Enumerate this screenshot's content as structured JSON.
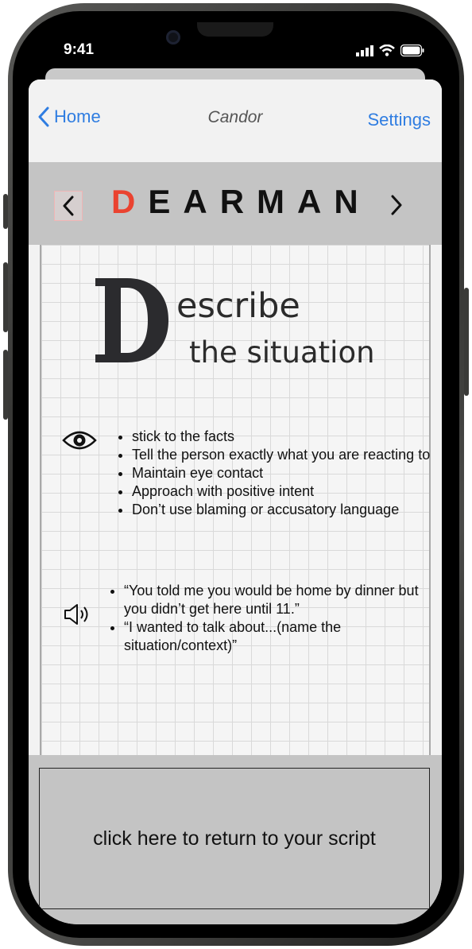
{
  "status_bar": {
    "time": "9:41"
  },
  "nav": {
    "back_label": "Home",
    "title": "Candor",
    "settings_label": "Settings"
  },
  "skill_bar": {
    "title_first_letter": "D",
    "title_rest": "EARMAN"
  },
  "content": {
    "heading_rest_line1": "escribe",
    "heading_line2": "the situation",
    "guidelines": [
      "stick to the facts",
      "Tell the person exactly what you are reacting to",
      "Maintain eye contact",
      "Approach with positive intent",
      "Don’t use blaming or accusatory language"
    ],
    "examples": [
      "“You told me you would be home by dinner but you didn’t get here until 11.”",
      "“I wanted to talk about...(name the situation/context)”"
    ]
  },
  "footer": {
    "return_label": "click here to return to your script"
  },
  "colors": {
    "accent": "#ea4330",
    "link": "#2f7de1",
    "bar": "#c4c4c4"
  },
  "icons": [
    "chevron-left-icon",
    "chevron-right-icon",
    "eye-icon",
    "speaker-icon",
    "signal-icon",
    "wifi-icon",
    "battery-icon"
  ]
}
